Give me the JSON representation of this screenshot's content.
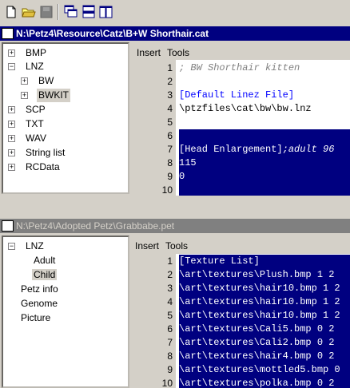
{
  "toolbar": {
    "buttons": [
      "new-file",
      "open-folder",
      "save-disabled",
      "cascade",
      "tile-horizontal",
      "tile-vertical"
    ]
  },
  "window1": {
    "title": "N:\\Petz4\\Resource\\Catz\\B+W Shorthair.cat",
    "tree": [
      "BMP",
      "LNZ",
      "BW",
      "BWKIT",
      "SCP",
      "TXT",
      "WAV",
      "String list",
      "RCData"
    ],
    "menu": [
      "Insert",
      "Tools"
    ],
    "lines": [
      {
        "n": "1",
        "text": "; BW Shorthair kitten"
      },
      {
        "n": "2",
        "text": ""
      },
      {
        "n": "3",
        "text": "[Default Linez File]"
      },
      {
        "n": "4",
        "text": "\\ptzfiles\\cat\\bw\\bw.lnz"
      },
      {
        "n": "5",
        "text": ""
      },
      {
        "n": "6",
        "text": ""
      },
      {
        "n": "7",
        "text": "[Head Enlargement]",
        "comment": ";adult 96"
      },
      {
        "n": "8",
        "text": "115"
      },
      {
        "n": "9",
        "text": "0"
      },
      {
        "n": "10",
        "text": ""
      }
    ]
  },
  "window2": {
    "title": "N:\\Petz4\\Adopted Petz\\Grabbabe.pet",
    "tree": [
      "LNZ",
      "Adult",
      "Child",
      "Petz info",
      "Genome",
      "Picture"
    ],
    "menu": [
      "Insert",
      "Tools"
    ],
    "lines": [
      {
        "n": "1",
        "text": "[Texture List]"
      },
      {
        "n": "2",
        "text": "\\art\\textures\\Plush.bmp 1 2"
      },
      {
        "n": "3",
        "text": "\\art\\textures\\hair10.bmp 1 2"
      },
      {
        "n": "4",
        "text": "\\art\\textures\\hair10.bmp 1 2"
      },
      {
        "n": "5",
        "text": "\\art\\textures\\hair10.bmp 1 2"
      },
      {
        "n": "6",
        "text": "\\art\\textures\\Cali5.bmp 0 2"
      },
      {
        "n": "7",
        "text": "\\art\\textures\\Cali2.bmp 0 2"
      },
      {
        "n": "8",
        "text": "\\art\\textures\\hair4.bmp 0 2"
      },
      {
        "n": "9",
        "text": "\\art\\textures\\mottled5.bmp 0"
      },
      {
        "n": "10",
        "text": "\\art\\textures\\polka.bmp 0 2"
      }
    ]
  },
  "colors": {
    "active_title": "#000080",
    "inactive_title": "#808080",
    "selection": "#000080"
  }
}
